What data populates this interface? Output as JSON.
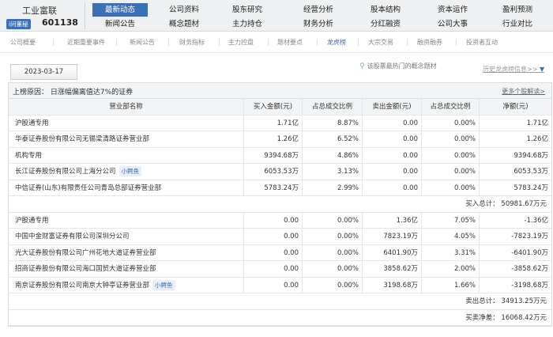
{
  "header": {
    "stock_name": "工业富联",
    "badge": "i问董秘",
    "stock_code": "601138",
    "menu": [
      {
        "label": "最新动态",
        "active": true
      },
      {
        "label": "公司资料"
      },
      {
        "label": "股东研究"
      },
      {
        "label": "经营分析"
      },
      {
        "label": "股本结构"
      },
      {
        "label": "资本运作"
      },
      {
        "label": "盈利预测"
      },
      {
        "label": "新闻公告"
      },
      {
        "label": "概念题材"
      },
      {
        "label": "主力持仓"
      },
      {
        "label": "财务分析"
      },
      {
        "label": "分红融资"
      },
      {
        "label": "公司大事"
      },
      {
        "label": "行业对比"
      }
    ]
  },
  "subnav": [
    "公司概要",
    "近期重要事件",
    "新闻公告",
    "财务指标",
    "主力控盘",
    "题材要点",
    "龙虎榜",
    "大宗交易",
    "融资融券",
    "投资者互动"
  ],
  "subnav_active": "龙虎榜",
  "date_tab": "2023-03-17",
  "concept_hint": "该股票最热门的概念题材",
  "history_link": "历史龙虎榜信息>>",
  "reason": {
    "text": "上榜原因： 日涨幅偏离值达7%的证券",
    "more": "更多个股解读>"
  },
  "columns": [
    "营业部名称",
    "买入金额(元)",
    "占总成交比例",
    "卖出金额(元)",
    "占总成交比例",
    "净额(元)"
  ],
  "buy_rows": [
    {
      "name": "沪股通专用",
      "buy": "1.71亿",
      "buy_pct": "8.87%",
      "sell": "0.00",
      "sell_pct": "0.00%",
      "net": "1.71亿"
    },
    {
      "name": "华泰证券股份有限公司无锡梁清路证券营业部",
      "buy": "1.26亿",
      "buy_pct": "6.52%",
      "sell": "0.00",
      "sell_pct": "0.00%",
      "net": "1.26亿"
    },
    {
      "name": "机构专用",
      "buy": "9394.68万",
      "buy_pct": "4.86%",
      "sell": "0.00",
      "sell_pct": "0.00%",
      "net": "9394.68万"
    },
    {
      "name": "长江证券股份有限公司上海分公司",
      "tag": "小鳄鱼",
      "buy": "6053.53万",
      "buy_pct": "3.13%",
      "sell": "0.00",
      "sell_pct": "0.00%",
      "net": "6053.53万"
    },
    {
      "name": "中信证券(山东)有限责任公司青岛总部证券营业部",
      "buy": "5783.24万",
      "buy_pct": "2.99%",
      "sell": "0.00",
      "sell_pct": "0.00%",
      "net": "5783.24万"
    }
  ],
  "buy_total": "买入总计： 50981.67万元",
  "sell_rows": [
    {
      "name": "沪股通专用",
      "buy": "0.00",
      "buy_pct": "0.00%",
      "sell": "1.36亿",
      "sell_pct": "7.05%",
      "net": "-1.36亿"
    },
    {
      "name": "中国中金财富证券有限公司深圳分公司",
      "buy": "0.00",
      "buy_pct": "0.00%",
      "sell": "7823.19万",
      "sell_pct": "4.05%",
      "net": "-7823.19万"
    },
    {
      "name": "光大证券股份有限公司广州花地大道证券营业部",
      "buy": "0.00",
      "buy_pct": "0.00%",
      "sell": "6401.90万",
      "sell_pct": "3.31%",
      "net": "-6401.90万"
    },
    {
      "name": "招商证券股份有限公司海口国贸大道证券营业部",
      "buy": "0.00",
      "buy_pct": "0.00%",
      "sell": "3858.62万",
      "sell_pct": "2.00%",
      "net": "-3858.62万"
    },
    {
      "name": "南京证券股份有限公司南京大钟亭证券营业部",
      "tag": "小鳄鱼",
      "buy": "0.00",
      "buy_pct": "0.00%",
      "sell": "3198.68万",
      "sell_pct": "1.66%",
      "net": "-3198.68万"
    }
  ],
  "sell_total": "卖出总计： 34913.25万元",
  "net_total": "买卖净差： 16068.42万元"
}
